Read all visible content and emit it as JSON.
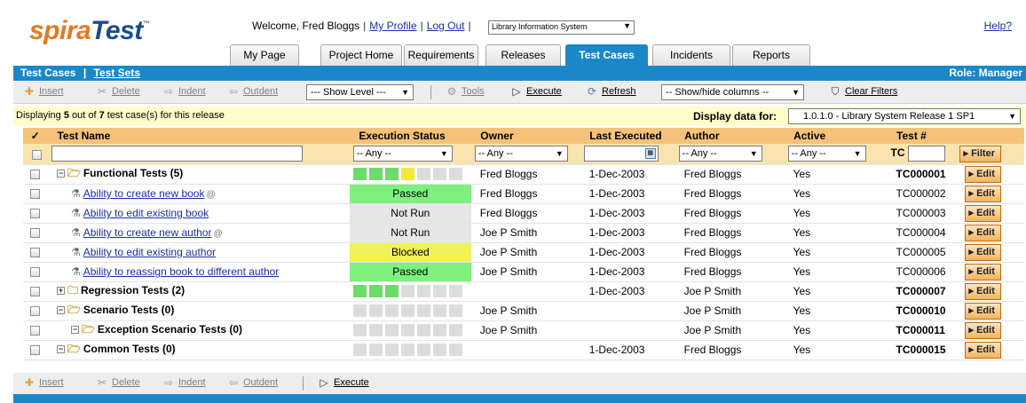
{
  "header": {
    "logo_spira": "spira",
    "logo_test": "Test",
    "welcome": "Welcome, Fred Bloggs",
    "my_profile": "My Profile",
    "log_out": "Log Out",
    "project_select": "Library Information System",
    "help": "Help?"
  },
  "tabs": [
    {
      "label": "My Page"
    },
    {
      "label": "Project Home"
    },
    {
      "label": "Requirements"
    },
    {
      "label": "Releases"
    },
    {
      "label": "Test Cases"
    },
    {
      "label": "Incidents"
    },
    {
      "label": "Reports"
    }
  ],
  "bluebar": {
    "test_cases": "Test Cases",
    "separator": "|",
    "test_sets": "Test Sets",
    "role": "Role: Manager"
  },
  "toolbar": {
    "insert": "Insert",
    "delete": "Delete",
    "indent": "Indent",
    "outdent": "Outdent",
    "show_level": "--- Show Level ---",
    "tools": "Tools",
    "execute": "Execute",
    "refresh": "Refresh",
    "show_hide_columns": "-- Show/hide columns --",
    "clear_filters": "Clear Filters"
  },
  "infobar": {
    "displaying_prefix": "Displaying ",
    "displayed_count": "5",
    "displaying_mid": " out of ",
    "total_count": "7",
    "displaying_suffix": " test case(s) for this release",
    "display_data_for": "Display data for:",
    "release": "1.0.1.0 - Library System Release 1 SP1"
  },
  "grid": {
    "columns": {
      "check": "✓",
      "name": "Test Name",
      "execution_status": "Execution Status",
      "owner": "Owner",
      "last_executed": "Last Executed",
      "author": "Author",
      "active": "Active",
      "test_num": "Test #"
    },
    "filter": {
      "any": "-- Any --",
      "tc_prefix": "TC",
      "filter_button": "Filter"
    },
    "edit_label": "Edit",
    "rows": [
      {
        "name": "Functional Tests (5)",
        "folder": true,
        "owner": "Fred Bloggs",
        "last_executed": "1-Dec-2003",
        "author": "Fred Bloggs",
        "active": "Yes",
        "test_num": "TC000001",
        "status": "",
        "bars": "g,g,g,y,n,n,n"
      },
      {
        "name": "Ability to create new book",
        "folder": false,
        "owner": "Fred Bloggs",
        "last_executed": "1-Dec-2003",
        "author": "Fred Bloggs",
        "active": "Yes",
        "test_num": "TC000002",
        "status": "Passed"
      },
      {
        "name": "Ability to edit existing book",
        "folder": false,
        "owner": "Fred Bloggs",
        "last_executed": "1-Dec-2003",
        "author": "Fred Bloggs",
        "active": "Yes",
        "test_num": "TC000003",
        "status": "Not Run"
      },
      {
        "name": "Ability to create new author",
        "folder": false,
        "owner": "Joe P Smith",
        "last_executed": "1-Dec-2003",
        "author": "Fred Bloggs",
        "active": "Yes",
        "test_num": "TC000004",
        "status": "Not Run"
      },
      {
        "name": "Ability to edit existing author",
        "folder": false,
        "owner": "Joe P Smith",
        "last_executed": "1-Dec-2003",
        "author": "Fred Bloggs",
        "active": "Yes",
        "test_num": "TC000005",
        "status": "Blocked"
      },
      {
        "name": "Ability to reassign book to different author",
        "folder": false,
        "owner": "Joe P Smith",
        "last_executed": "1-Dec-2003",
        "author": "Fred Bloggs",
        "active": "Yes",
        "test_num": "TC000006",
        "status": "Passed"
      },
      {
        "name": "Regression Tests (2)",
        "folder": true,
        "owner": "",
        "last_executed": "1-Dec-2003",
        "author": "Joe P Smith",
        "active": "Yes",
        "test_num": "TC000007",
        "status": "",
        "bars": "g,g,g,n,n,n,n"
      },
      {
        "name": "Scenario Tests (0)",
        "folder": true,
        "owner": "Joe P Smith",
        "last_executed": "",
        "author": "Joe P Smith",
        "active": "Yes",
        "test_num": "TC000010",
        "status": "",
        "bars": "n,n,n,n,n,n,n"
      },
      {
        "name": "Exception Scenario Tests (0)",
        "folder": true,
        "owner": "Joe P Smith",
        "last_executed": "",
        "author": "Joe P Smith",
        "active": "Yes",
        "test_num": "TC000011",
        "status": "",
        "bars": "n,n,n,n,n,n,n"
      },
      {
        "name": "Common Tests (0)",
        "folder": true,
        "owner": "",
        "last_executed": "1-Dec-2003",
        "author": "Fred Bloggs",
        "active": "Yes",
        "test_num": "TC000015",
        "status": "",
        "bars": "n,n,n,n,n,n,n"
      }
    ]
  },
  "colors": {
    "accent_blue": "#1a88c8",
    "header_orange": "#f5c27a",
    "passed": "#7ef07e",
    "blocked": "#f2f256",
    "not_run": "#e6e6e6"
  }
}
